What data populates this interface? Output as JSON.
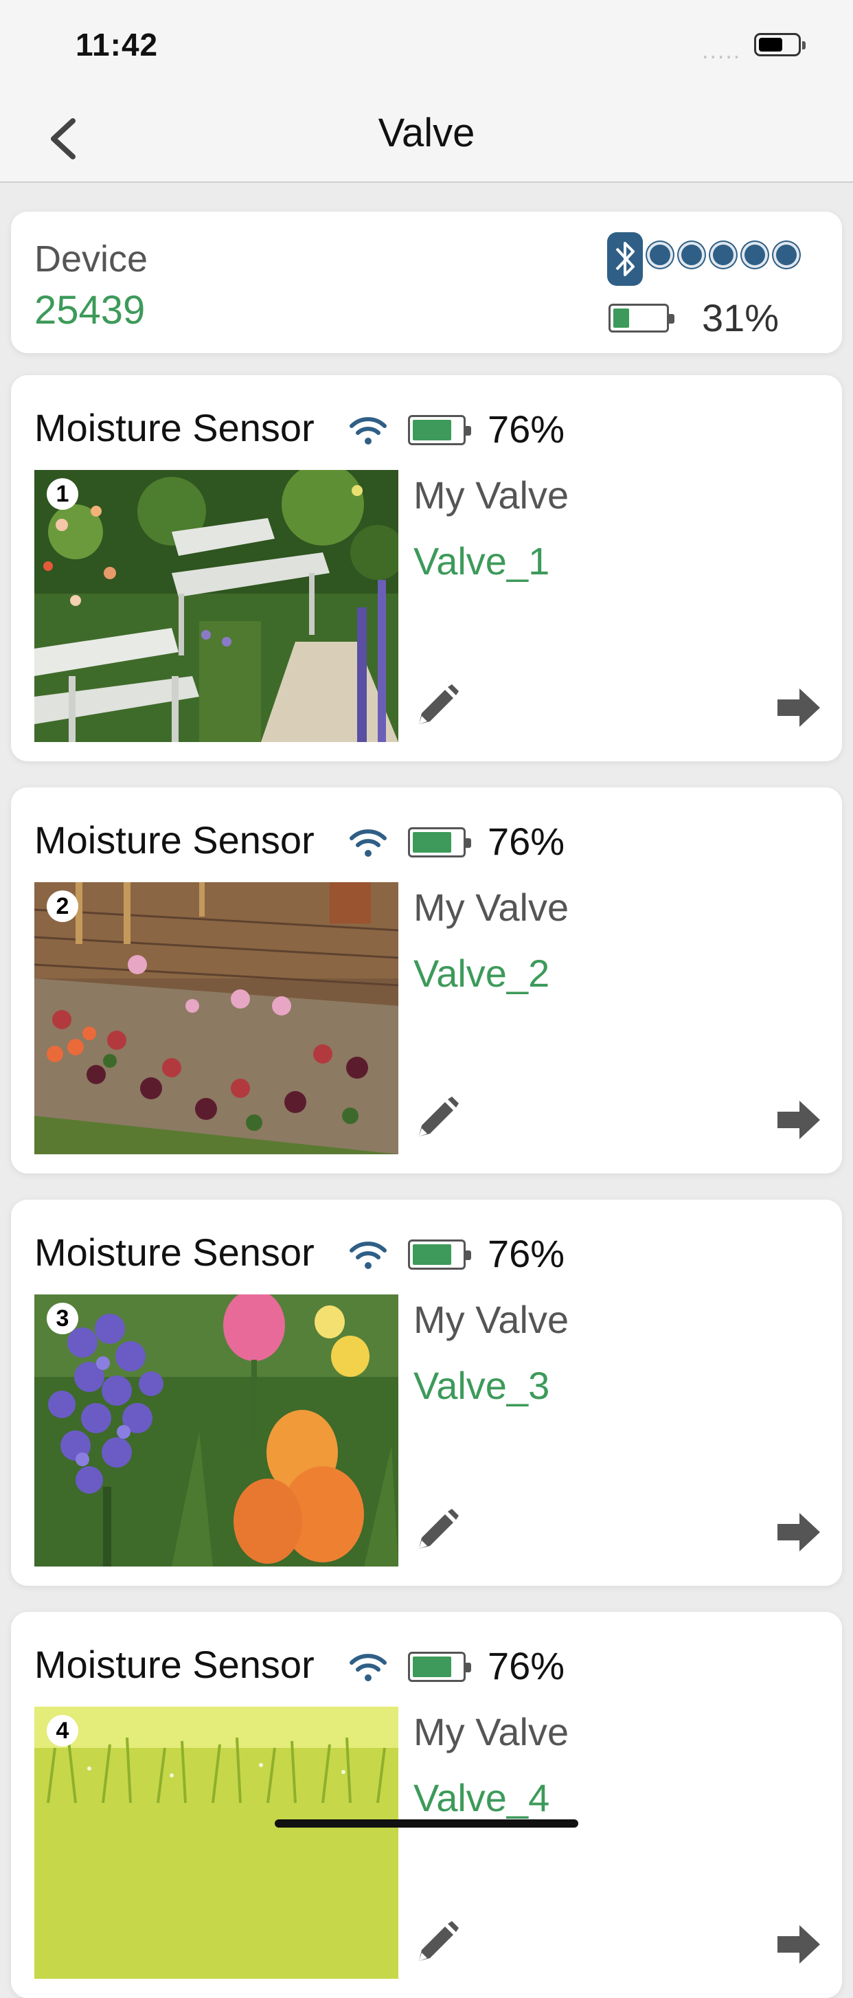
{
  "status": {
    "time": "11:42",
    "signal": "....."
  },
  "nav": {
    "title": "Valve"
  },
  "device": {
    "label": "Device",
    "id": "25439",
    "battery_pct": "31%",
    "battery_level": 0.31,
    "connection_dots": 5
  },
  "cards": [
    {
      "sensor": "Moisture Sensor",
      "battery": "76%",
      "battery_level": 0.76,
      "index": "1",
      "name_label": "My Valve",
      "name": "Valve_1",
      "photo": "garden-benches"
    },
    {
      "sensor": "Moisture Sensor",
      "battery": "76%",
      "battery_level": 0.76,
      "index": "2",
      "name_label": "My Valve",
      "name": "Valve_2",
      "photo": "flower-bed-deck"
    },
    {
      "sensor": "Moisture Sensor",
      "battery": "76%",
      "battery_level": 0.76,
      "index": "3",
      "name_label": "My Valve",
      "name": "Valve_3",
      "photo": "hyacinth-tulips"
    },
    {
      "sensor": "Moisture Sensor",
      "battery": "76%",
      "battery_level": 0.76,
      "index": "4",
      "name_label": "My Valve",
      "name": "Valve_4",
      "photo": "grass"
    }
  ],
  "colors": {
    "accent_green": "#3d9a5a",
    "bluetooth_blue": "#2f5f86",
    "background": "#ececec"
  },
  "icons": {
    "back": "chevron-left-icon",
    "bluetooth": "bluetooth-icon",
    "wifi": "wifi-icon",
    "battery": "battery-icon",
    "edit": "pencil-icon",
    "go": "arrow-right-icon"
  }
}
